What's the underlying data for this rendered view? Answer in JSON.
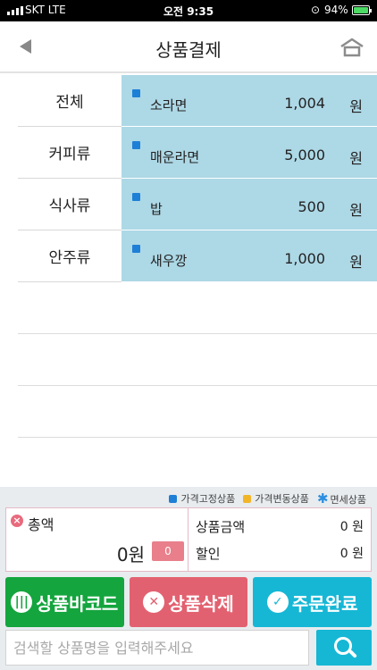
{
  "statusbar": {
    "carrier": "SKT  LTE",
    "time": "오전 9:35",
    "battery": "94%"
  },
  "header": {
    "title": "상품결제"
  },
  "categories": [
    "전체",
    "커피류",
    "식사류",
    "안주류"
  ],
  "products": [
    {
      "name": "소라면",
      "price": "1,004",
      "unit": "원"
    },
    {
      "name": "매운라면",
      "price": "5,000",
      "unit": "원"
    },
    {
      "name": "밥",
      "price": "500",
      "unit": "원"
    },
    {
      "name": "새우깡",
      "price": "1,000",
      "unit": "원"
    }
  ],
  "legend": {
    "fixed": "가격고정상품",
    "variable": "가격변동상품",
    "taxfree": "면세상품"
  },
  "colors": {
    "fixed": "#1e7fd6",
    "variable": "#f3b528",
    "taxfree": "#2c8ee0"
  },
  "totals": {
    "label": "총액",
    "amount": "0원",
    "badge": "0",
    "product_amount_label": "상품금액",
    "product_amount_value": "0 원",
    "discount_label": "할인",
    "discount_value": "0 원"
  },
  "buttons": {
    "barcode": "상품바코드",
    "delete": "상품삭제",
    "complete": "주문완료"
  },
  "search": {
    "placeholder": "검색할 상품명을 입력해주세요"
  }
}
